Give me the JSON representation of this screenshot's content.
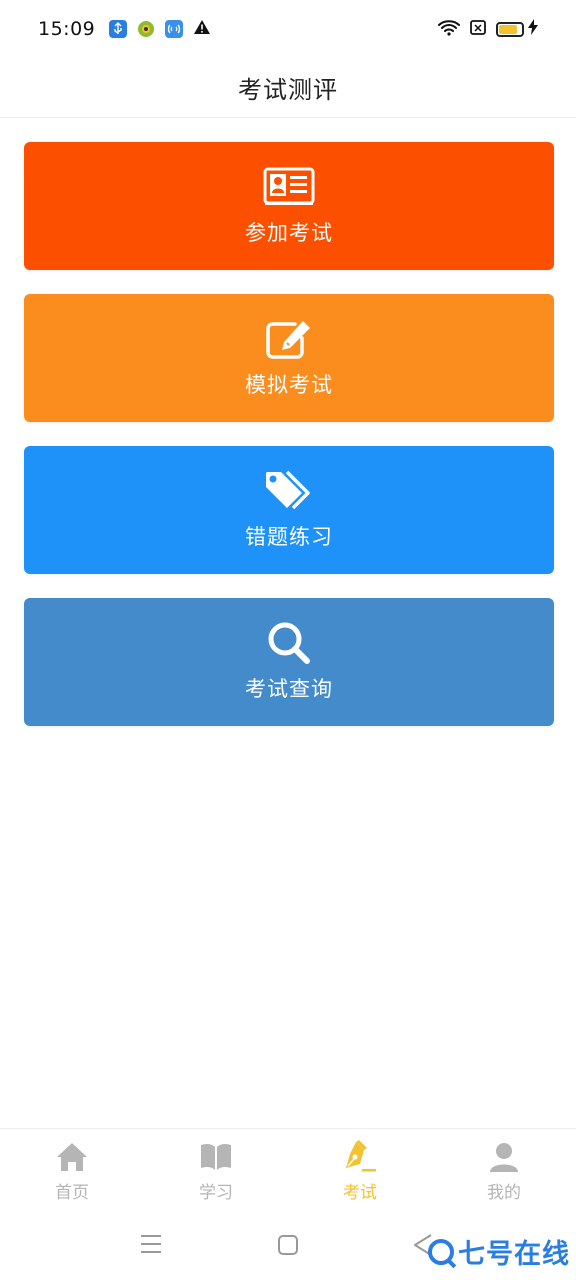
{
  "status_bar": {
    "time": "15:09",
    "left_icons": [
      "usb-icon",
      "ball-icon",
      "nfc-icon",
      "warning-icon"
    ],
    "right_icons": [
      "wifi-icon",
      "sim-icon",
      "battery-icon",
      "charging-icon"
    ],
    "battery_level": 0.85
  },
  "header": {
    "title": "考试测评"
  },
  "cards": [
    {
      "label": "参加考试",
      "icon": "id-card-icon",
      "color": "#fc5000"
    },
    {
      "label": "模拟考试",
      "icon": "edit-icon",
      "color": "#fb8c1e"
    },
    {
      "label": "错题练习",
      "icon": "tags-icon",
      "color": "#1f92fa"
    },
    {
      "label": "考试查询",
      "icon": "search-icon",
      "color": "#438bcb"
    }
  ],
  "bottom_nav": {
    "items": [
      {
        "label": "首页",
        "icon": "home-icon",
        "active": false
      },
      {
        "label": "学习",
        "icon": "book-icon",
        "active": false
      },
      {
        "label": "考试",
        "icon": "pen-icon",
        "active": true
      },
      {
        "label": "我的",
        "icon": "user-icon",
        "active": false
      }
    ],
    "active_color": "#f2c230",
    "inactive_color": "#b5b5b5"
  },
  "system_nav": {
    "buttons": [
      "menu-icon",
      "home-square-icon",
      "back-icon"
    ]
  },
  "watermark": {
    "text": "七号在线"
  }
}
